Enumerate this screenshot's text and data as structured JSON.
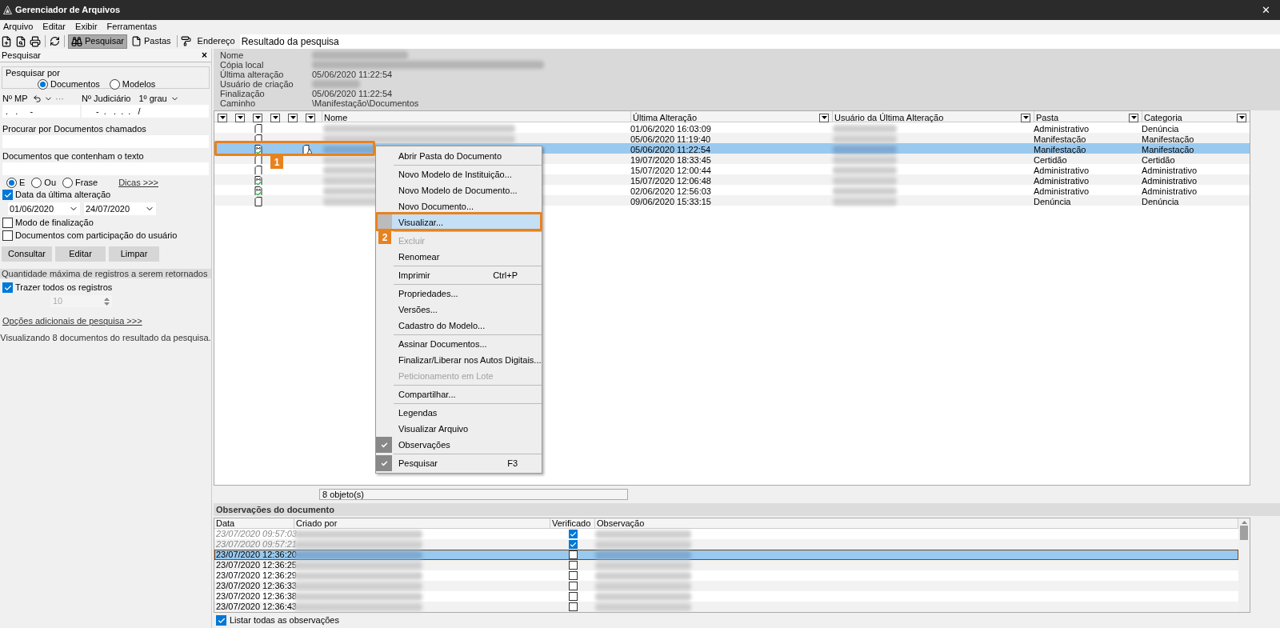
{
  "window": {
    "title": "Gerenciador de Arquivos",
    "close": "✕"
  },
  "menu": [
    "Arquivo",
    "Editar",
    "Exibir",
    "Ferramentas"
  ],
  "toolbar": {
    "search_button": {
      "label": "Pesquisar",
      "selected": true
    },
    "folders_button": {
      "label": "Pastas",
      "selected": false
    },
    "address_label": "Endereço",
    "address": "Resultado da pesquisa"
  },
  "search_panel": {
    "title": "Pesquisar",
    "close": "×",
    "group_label": "Pesquisar por",
    "search_by": [
      {
        "label": "Documentos",
        "selected": true
      },
      {
        "label": "Modelos",
        "selected": false
      }
    ],
    "mp_label": "Nº MP",
    "mp_more": "···",
    "mp_value": ".   .     -",
    "jud_label": "Nº Judiciário",
    "grade": "1º grau",
    "jud_value": "-  .   .  .  .   /",
    "name_label": "Procurar por Documentos chamados",
    "text_label": "Documentos que contenham o texto",
    "text_mode": [
      {
        "label": "E",
        "selected": true
      },
      {
        "label": "Ou",
        "selected": false
      },
      {
        "label": "Frase",
        "selected": false
      }
    ],
    "tips_link": "Dicas >>>",
    "date_filter": {
      "label": "Data da última alteração",
      "checked": true
    },
    "date_from": "01/06/2020",
    "date_to": "24/07/2020",
    "options": [
      {
        "label": "Modo de finalização",
        "checked": false
      },
      {
        "label": "Documentos com participação do usuário",
        "checked": false
      }
    ],
    "buttons": [
      "Consultar",
      "Editar",
      "Limpar"
    ],
    "max_section": "Quantidade máxima de registros a serem retornados",
    "bring_all": {
      "label": "Trazer todos os registros",
      "checked": true
    },
    "max_value": "10",
    "more_options": "Opções adicionais de pesquisa >>>",
    "summary": "Visualizando 8 documentos do resultado da pesquisa."
  },
  "info": [
    {
      "label": "Nome",
      "blurred": true
    },
    {
      "label": "Cópia local",
      "blurred": true
    },
    {
      "label": "Última alteração",
      "value": "05/06/2020 11:22:54",
      "blurred": false
    },
    {
      "label": "Usuário de criação",
      "blurred": true
    },
    {
      "label": "Finalização",
      "value": "05/06/2020 11:22:54",
      "blurred": false
    },
    {
      "label": "Caminho",
      "value": "\\Manifestação\\Documentos",
      "blurred": false
    }
  ],
  "documents": {
    "columns": [
      "Nome",
      "Última Alteração",
      "Usuário da Última Alteração",
      "Pasta",
      "Categoria"
    ],
    "rows": [
      {
        "kind": "document",
        "signed": false,
        "modified": "01/06/2020 16:03:09",
        "folder": "Administrativo",
        "category": "Denúncia",
        "selected": false
      },
      {
        "kind": "document",
        "signed": false,
        "modified": "05/06/2020 11:19:40",
        "folder": "Manifestação",
        "category": "Manifestação",
        "selected": false
      },
      {
        "kind": "model",
        "signed": true,
        "modified": "05/06/2020 11:22:54",
        "folder": "Manifestação",
        "category": "Manifestação",
        "selected": true
      },
      {
        "kind": "document",
        "signed": false,
        "modified": "19/07/2020 18:33:45",
        "folder": "Certidão",
        "category": "Certidão",
        "selected": false
      },
      {
        "kind": "document",
        "signed": false,
        "modified": "15/07/2020 12:00:44",
        "folder": "Administrativo",
        "category": "Administrativo",
        "selected": false
      },
      {
        "kind": "model",
        "signed": false,
        "modified": "15/07/2020 12:06:48",
        "folder": "Administrativo",
        "category": "Administrativo",
        "selected": false
      },
      {
        "kind": "model",
        "signed": false,
        "modified": "02/06/2020 12:56:03",
        "folder": "Administrativo",
        "category": "Administrativo",
        "selected": false
      },
      {
        "kind": "document",
        "signed": false,
        "modified": "09/06/2020 15:33:15",
        "folder": "Denúncia",
        "category": "Denúncia",
        "selected": false
      }
    ],
    "status": "8 objeto(s)"
  },
  "context_menu": [
    {
      "kind": "item",
      "label": "Abrir Pasta do Documento",
      "disabled": false,
      "checked": false,
      "selected": false
    },
    {
      "kind": "separator"
    },
    {
      "kind": "item",
      "label": "Novo Modelo de Instituição...",
      "disabled": false,
      "checked": false,
      "selected": false
    },
    {
      "kind": "item",
      "label": "Novo Modelo de Documento...",
      "disabled": false,
      "checked": false,
      "selected": false
    },
    {
      "kind": "item",
      "label": "Novo Documento...",
      "disabled": false,
      "checked": false,
      "selected": false
    },
    {
      "kind": "item",
      "label": "Visualizar...",
      "disabled": false,
      "checked": false,
      "selected": true
    },
    {
      "kind": "separator"
    },
    {
      "kind": "item",
      "label": "Excluir",
      "disabled": true,
      "checked": false,
      "selected": false
    },
    {
      "kind": "item",
      "label": "Renomear",
      "disabled": false,
      "checked": false,
      "selected": false
    },
    {
      "kind": "separator"
    },
    {
      "kind": "item",
      "label": "Imprimir",
      "shortcut": "Ctrl+P",
      "disabled": false,
      "checked": false,
      "selected": false
    },
    {
      "kind": "separator"
    },
    {
      "kind": "item",
      "label": "Propriedades...",
      "disabled": false,
      "checked": false,
      "selected": false
    },
    {
      "kind": "item",
      "label": "Versões...",
      "disabled": false,
      "checked": false,
      "selected": false
    },
    {
      "kind": "item",
      "label": "Cadastro do Modelo...",
      "disabled": false,
      "checked": false,
      "selected": false
    },
    {
      "kind": "separator"
    },
    {
      "kind": "item",
      "label": "Assinar Documentos...",
      "disabled": false,
      "checked": false,
      "selected": false
    },
    {
      "kind": "item",
      "label": "Finalizar/Liberar nos Autos Digitais...",
      "disabled": false,
      "checked": false,
      "selected": false
    },
    {
      "kind": "item",
      "label": "Peticionamento em Lote",
      "disabled": true,
      "checked": false,
      "selected": false
    },
    {
      "kind": "separator"
    },
    {
      "kind": "item",
      "label": "Compartilhar...",
      "disabled": false,
      "checked": false,
      "selected": false
    },
    {
      "kind": "separator"
    },
    {
      "kind": "item",
      "label": "Legendas",
      "disabled": false,
      "checked": false,
      "selected": false
    },
    {
      "kind": "item",
      "label": "Visualizar Arquivo",
      "disabled": false,
      "checked": false,
      "selected": false
    },
    {
      "kind": "item",
      "label": "Observações",
      "disabled": false,
      "checked": true,
      "selected": false
    },
    {
      "kind": "separator"
    },
    {
      "kind": "item",
      "label": "Pesquisar",
      "shortcut": "F3",
      "disabled": false,
      "checked": true,
      "selected": false
    }
  ],
  "callouts": [
    "1",
    "2"
  ],
  "observations": {
    "title": "Observações do documento",
    "columns": [
      "Data",
      "Criado por",
      "Verificado",
      "Observação"
    ],
    "rows": [
      {
        "date": "23/07/2020 09:57:03",
        "verified": true,
        "selected": false
      },
      {
        "date": "23/07/2020 09:57:21",
        "verified": true,
        "selected": false
      },
      {
        "date": "23/07/2020 12:36:20",
        "verified": false,
        "selected": true
      },
      {
        "date": "23/07/2020 12:36:25",
        "verified": false,
        "selected": false
      },
      {
        "date": "23/07/2020 12:36:29",
        "verified": false,
        "selected": false
      },
      {
        "date": "23/07/2020 12:36:33",
        "verified": false,
        "selected": false
      },
      {
        "date": "23/07/2020 12:36:38",
        "verified": false,
        "selected": false
      },
      {
        "date": "23/07/2020 12:36:43",
        "verified": false,
        "selected": false
      }
    ],
    "list_all": {
      "label": "Listar todas as observações",
      "checked": true
    }
  }
}
